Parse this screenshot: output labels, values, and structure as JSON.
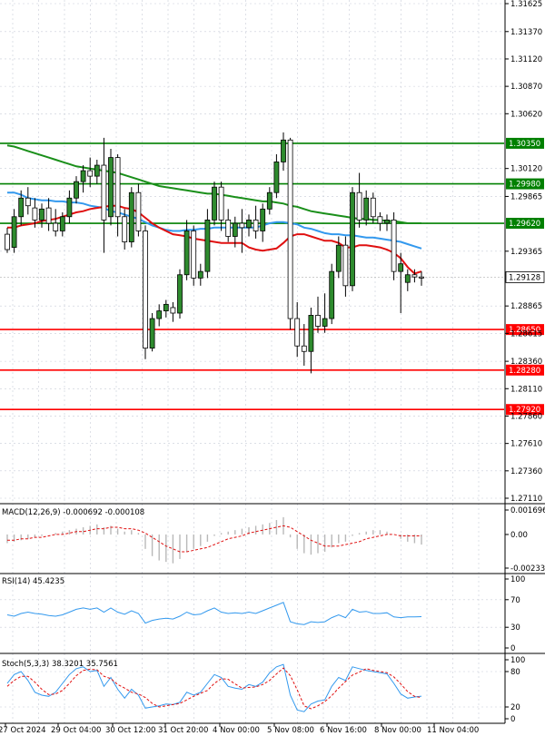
{
  "chart_data": {
    "type": "candlestick",
    "symbol_hint": "GBPUSD H4",
    "price_axis": {
      "ticks": [
        "1.31625",
        "1.31370",
        "1.31120",
        "1.30870",
        "1.30620",
        "1.30120",
        "1.29865",
        "1.29365",
        "1.28865",
        "1.28615",
        "1.28360",
        "1.28110",
        "1.27860",
        "1.27610",
        "1.27360",
        "1.27110"
      ],
      "range": [
        1.2711,
        1.3163
      ]
    },
    "time_axis": {
      "labels": [
        "27 Oct 2024",
        "29 Oct 04:00",
        "30 Oct 12:00",
        "31 Oct 20:00",
        "4 Nov 00:00",
        "5 Nov 08:00",
        "6 Nov 16:00",
        "8 Nov 00:00",
        "11 Nov 04:00"
      ]
    },
    "current_price": {
      "label": "1.29128",
      "value": 1.29128
    },
    "levels": [
      {
        "label": "1.30350",
        "value": 1.3035,
        "color": "#008000"
      },
      {
        "label": "1.29980",
        "value": 1.2998,
        "color": "#008000"
      },
      {
        "label": "1.29620",
        "value": 1.2962,
        "color": "#008000"
      },
      {
        "label": "1.28650",
        "value": 1.2865,
        "color": "#ff0000"
      },
      {
        "label": "1.28280",
        "value": 1.2828,
        "color": "#ff0000"
      },
      {
        "label": "1.27920",
        "value": 1.2792,
        "color": "#ff0000"
      }
    ],
    "candles": [
      {
        "o": 1.2952,
        "h": 1.2958,
        "c": 1.2938,
        "l": 1.2935
      },
      {
        "o": 1.294,
        "h": 1.2975,
        "c": 1.2968,
        "l": 1.2935
      },
      {
        "o": 1.2968,
        "h": 1.2992,
        "c": 1.2985,
        "l": 1.296
      },
      {
        "o": 1.2985,
        "h": 1.2995,
        "c": 1.2978,
        "l": 1.297
      },
      {
        "o": 1.2976,
        "h": 1.2985,
        "c": 1.2965,
        "l": 1.2958
      },
      {
        "o": 1.2965,
        "h": 1.298,
        "c": 1.2975,
        "l": 1.2958
      },
      {
        "o": 1.2976,
        "h": 1.2985,
        "c": 1.2962,
        "l": 1.2955
      },
      {
        "o": 1.2962,
        "h": 1.2975,
        "c": 1.2955,
        "l": 1.295
      },
      {
        "o": 1.2955,
        "h": 1.2972,
        "c": 1.2968,
        "l": 1.295
      },
      {
        "o": 1.2968,
        "h": 1.2992,
        "c": 1.2985,
        "l": 1.2962
      },
      {
        "o": 1.2985,
        "h": 1.3005,
        "c": 1.3,
        "l": 1.298
      },
      {
        "o": 1.3,
        "h": 1.3015,
        "c": 1.301,
        "l": 1.299
      },
      {
        "o": 1.301,
        "h": 1.3022,
        "c": 1.3005,
        "l": 1.2995
      },
      {
        "o": 1.3005,
        "h": 1.302,
        "c": 1.3015,
        "l": 1.2998
      },
      {
        "o": 1.3015,
        "h": 1.304,
        "c": 1.2965,
        "l": 1.2935
      },
      {
        "o": 1.2968,
        "h": 1.303,
        "c": 1.3022,
        "l": 1.296
      },
      {
        "o": 1.3022,
        "h": 1.3025,
        "c": 1.2968,
        "l": 1.295
      },
      {
        "o": 1.2968,
        "h": 1.2975,
        "c": 1.2945,
        "l": 1.2938
      },
      {
        "o": 1.2945,
        "h": 1.2995,
        "c": 1.299,
        "l": 1.294
      },
      {
        "o": 1.299,
        "h": 1.2998,
        "c": 1.2955,
        "l": 1.295
      },
      {
        "o": 1.2955,
        "h": 1.296,
        "c": 1.2848,
        "l": 1.2838
      },
      {
        "o": 1.2848,
        "h": 1.288,
        "c": 1.2875,
        "l": 1.2845
      },
      {
        "o": 1.2875,
        "h": 1.2888,
        "c": 1.2882,
        "l": 1.2868
      },
      {
        "o": 1.2882,
        "h": 1.2892,
        "c": 1.2888,
        "l": 1.2876
      },
      {
        "o": 1.2885,
        "h": 1.289,
        "c": 1.288,
        "l": 1.2872
      },
      {
        "o": 1.288,
        "h": 1.292,
        "c": 1.2915,
        "l": 1.2875
      },
      {
        "o": 1.2915,
        "h": 1.2965,
        "c": 1.2955,
        "l": 1.291
      },
      {
        "o": 1.2955,
        "h": 1.296,
        "c": 1.2912,
        "l": 1.2905
      },
      {
        "o": 1.2912,
        "h": 1.2925,
        "c": 1.2918,
        "l": 1.2905
      },
      {
        "o": 1.2918,
        "h": 1.2975,
        "c": 1.2965,
        "l": 1.2912
      },
      {
        "o": 1.2965,
        "h": 1.3,
        "c": 1.2995,
        "l": 1.296
      },
      {
        "o": 1.2995,
        "h": 1.3,
        "c": 1.2965,
        "l": 1.2955
      },
      {
        "o": 1.2965,
        "h": 1.2975,
        "c": 1.295,
        "l": 1.2945
      },
      {
        "o": 1.295,
        "h": 1.2968,
        "c": 1.2962,
        "l": 1.294
      },
      {
        "o": 1.2962,
        "h": 1.2975,
        "c": 1.2958,
        "l": 1.2935
      },
      {
        "o": 1.2958,
        "h": 1.297,
        "c": 1.2965,
        "l": 1.295
      },
      {
        "o": 1.2965,
        "h": 1.2978,
        "c": 1.2955,
        "l": 1.2948
      },
      {
        "o": 1.2955,
        "h": 1.298,
        "c": 1.2975,
        "l": 1.2945
      },
      {
        "o": 1.2975,
        "h": 1.2995,
        "c": 1.299,
        "l": 1.297
      },
      {
        "o": 1.299,
        "h": 1.3025,
        "c": 1.3018,
        "l": 1.2985
      },
      {
        "o": 1.3018,
        "h": 1.3045,
        "c": 1.3038,
        "l": 1.301
      },
      {
        "o": 1.3038,
        "h": 1.304,
        "c": 1.2875,
        "l": 1.2865
      },
      {
        "o": 1.2875,
        "h": 1.289,
        "c": 1.285,
        "l": 1.284
      },
      {
        "o": 1.285,
        "h": 1.287,
        "c": 1.2845,
        "l": 1.2832
      },
      {
        "o": 1.2845,
        "h": 1.2885,
        "c": 1.2878,
        "l": 1.2825
      },
      {
        "o": 1.2878,
        "h": 1.2895,
        "c": 1.2868,
        "l": 1.2862
      },
      {
        "o": 1.2868,
        "h": 1.2898,
        "c": 1.2875,
        "l": 1.2862
      },
      {
        "o": 1.2875,
        "h": 1.2925,
        "c": 1.2918,
        "l": 1.287
      },
      {
        "o": 1.2918,
        "h": 1.295,
        "c": 1.2942,
        "l": 1.2912
      },
      {
        "o": 1.2942,
        "h": 1.295,
        "c": 1.2905,
        "l": 1.2895
      },
      {
        "o": 1.2905,
        "h": 1.2995,
        "c": 1.299,
        "l": 1.29
      },
      {
        "o": 1.299,
        "h": 1.3008,
        "c": 1.2965,
        "l": 1.2958
      },
      {
        "o": 1.2965,
        "h": 1.2992,
        "c": 1.2985,
        "l": 1.296
      },
      {
        "o": 1.2985,
        "h": 1.299,
        "c": 1.2968,
        "l": 1.2962
      },
      {
        "o": 1.2968,
        "h": 1.2972,
        "c": 1.2962,
        "l": 1.2955
      },
      {
        "o": 1.2962,
        "h": 1.297,
        "c": 1.2965,
        "l": 1.2955
      },
      {
        "o": 1.2965,
        "h": 1.2972,
        "c": 1.2918,
        "l": 1.291
      },
      {
        "o": 1.2918,
        "h": 1.2935,
        "c": 1.2925,
        "l": 1.288
      },
      {
        "o": 1.2908,
        "h": 1.292,
        "c": 1.2915,
        "l": 1.29
      },
      {
        "o": 1.2915,
        "h": 1.292,
        "c": 1.2913,
        "l": 1.2908
      },
      {
        "o": 1.2913,
        "h": 1.2918,
        "c": 1.2912,
        "l": 1.2905
      }
    ],
    "ma_red": [
      1.2958,
      1.2958,
      1.296,
      1.2961,
      1.2962,
      1.2964,
      1.2965,
      1.2966,
      1.2968,
      1.297,
      1.2972,
      1.2973,
      1.2975,
      1.2976,
      1.2977,
      1.2978,
      1.2978,
      1.2976,
      1.2975,
      1.2972,
      1.2967,
      1.2962,
      1.2958,
      1.2955,
      1.2952,
      1.2951,
      1.295,
      1.2948,
      1.2947,
      1.2946,
      1.2945,
      1.2944,
      1.2944,
      1.2944,
      1.2944,
      1.294,
      1.2938,
      1.2937,
      1.2938,
      1.2939,
      1.2944,
      1.295,
      1.2952,
      1.2952,
      1.295,
      1.2948,
      1.2946,
      1.2946,
      1.2944,
      1.294,
      1.294,
      1.2942,
      1.2942,
      1.2941,
      1.294,
      1.2938,
      1.2935,
      1.293,
      1.2922,
      1.2916,
      1.2918
    ],
    "ma_blue": [
      1.299,
      1.299,
      1.2988,
      1.2985,
      1.2984,
      1.2983,
      1.2983,
      1.2982,
      1.2982,
      1.2981,
      1.2981,
      1.298,
      1.2978,
      1.2977,
      1.2976,
      1.2973,
      1.2972,
      1.297,
      1.2968,
      1.2966,
      1.2963,
      1.296,
      1.2958,
      1.2956,
      1.2955,
      1.2955,
      1.2956,
      1.2956,
      1.2957,
      1.2957,
      1.2958,
      1.2958,
      1.2958,
      1.2958,
      1.2958,
      1.2958,
      1.2958,
      1.296,
      1.2962,
      1.2963,
      1.2963,
      1.2962,
      1.2961,
      1.2958,
      1.2957,
      1.2955,
      1.2953,
      1.2952,
      1.2952,
      1.2951,
      1.2951,
      1.295,
      1.2949,
      1.2949,
      1.2948,
      1.2947,
      1.2946,
      1.2945,
      1.2943,
      1.2941,
      1.2939
    ],
    "ma_green": [
      1.3033,
      1.3032,
      1.303,
      1.3028,
      1.3026,
      1.3024,
      1.3022,
      1.302,
      1.3018,
      1.3016,
      1.3014,
      1.3013,
      1.3012,
      1.3011,
      1.301,
      1.3009,
      1.3008,
      1.3006,
      1.3004,
      1.3002,
      1.3,
      1.2998,
      1.2996,
      1.2995,
      1.2994,
      1.2993,
      1.2992,
      1.2991,
      1.299,
      1.2989,
      1.2989,
      1.2988,
      1.2987,
      1.2986,
      1.2985,
      1.2984,
      1.2983,
      1.2982,
      1.2982,
      1.2981,
      1.298,
      1.2978,
      1.2977,
      1.2975,
      1.2973,
      1.2972,
      1.2971,
      1.297,
      1.2969,
      1.2968,
      1.2967,
      1.2966,
      1.2966,
      1.2965,
      1.2965,
      1.2964,
      1.2964,
      1.2963,
      1.2962,
      1.2962,
      1.2962
    ],
    "macd": {
      "label": "MACD(12,26,9) -0.000692 -0.000108",
      "ticks": [
        "0.001696",
        "0.00",
        "-0.002332"
      ],
      "range": [
        -0.002332,
        0.001696
      ],
      "hist": [
        -0.0006,
        -0.0005,
        -0.0004,
        -0.0003,
        -0.0002,
        -0.0001,
        0.0,
        0.0001,
        0.0002,
        0.0003,
        0.0004,
        0.0005,
        0.0006,
        0.0007,
        0.0005,
        0.0006,
        0.0004,
        0.0002,
        0.0003,
        0.0001,
        -0.001,
        -0.0015,
        -0.0018,
        -0.0019,
        -0.002,
        -0.0017,
        -0.0012,
        -0.001,
        -0.0008,
        -0.0005,
        -0.0001,
        0.0001,
        0.0002,
        0.0003,
        0.0004,
        0.0005,
        0.0006,
        0.0007,
        0.0008,
        0.001,
        0.0012,
        -0.0002,
        -0.001,
        -0.0013,
        -0.0014,
        -0.0013,
        -0.0012,
        -0.0009,
        -0.0006,
        -0.0005,
        -0.0001,
        0.0001,
        0.0002,
        0.0003,
        0.0003,
        0.0002,
        0.0,
        -0.0003,
        -0.0005,
        -0.0006,
        -0.0007
      ],
      "signal": [
        -0.0004,
        -0.0004,
        -0.0003,
        -0.0003,
        -0.0002,
        -0.0002,
        -0.0001,
        0.0,
        0.0,
        0.0001,
        0.0002,
        0.0002,
        0.0003,
        0.0004,
        0.0004,
        0.0005,
        0.0005,
        0.0004,
        0.0004,
        0.0003,
        0.0001,
        -0.0002,
        -0.0005,
        -0.0008,
        -0.001,
        -0.0012,
        -0.0012,
        -0.0011,
        -0.001,
        -0.0009,
        -0.0007,
        -0.0005,
        -0.0003,
        -0.0002,
        -0.0001,
        0.0001,
        0.0002,
        0.0003,
        0.0004,
        0.0005,
        0.0006,
        0.0005,
        0.0002,
        -0.0001,
        -0.0004,
        -0.0006,
        -0.0008,
        -0.0008,
        -0.0008,
        -0.0007,
        -0.0006,
        -0.0005,
        -0.0003,
        -0.0002,
        -0.0001,
        0.0,
        0.0,
        -0.0001,
        -0.0001,
        -0.0001,
        -0.0001
      ]
    },
    "rsi": {
      "label": "RSI(14) 45.4235",
      "ticks": [
        "100",
        "70",
        "30",
        "0"
      ],
      "values": [
        48,
        46,
        50,
        52,
        50,
        49,
        47,
        46,
        48,
        52,
        56,
        58,
        56,
        58,
        52,
        58,
        52,
        49,
        54,
        50,
        36,
        40,
        42,
        43,
        42,
        46,
        52,
        48,
        49,
        54,
        58,
        52,
        50,
        51,
        50,
        52,
        50,
        54,
        58,
        62,
        66,
        38,
        35,
        34,
        38,
        37,
        38,
        44,
        48,
        44,
        56,
        52,
        53,
        50,
        50,
        51,
        45,
        44,
        45,
        45,
        45.4
      ]
    },
    "stoch": {
      "label": "Stoch(5,3,3) 38.3201 35.7561",
      "ticks": [
        "100",
        "80",
        "20",
        "0"
      ],
      "k": [
        60,
        75,
        80,
        65,
        45,
        40,
        38,
        45,
        60,
        75,
        85,
        88,
        80,
        82,
        55,
        70,
        50,
        35,
        50,
        40,
        18,
        20,
        22,
        25,
        24,
        28,
        45,
        40,
        45,
        60,
        75,
        70,
        55,
        52,
        50,
        58,
        55,
        62,
        78,
        88,
        92,
        40,
        15,
        12,
        25,
        30,
        32,
        55,
        70,
        65,
        88,
        85,
        82,
        80,
        78,
        76,
        60,
        42,
        35,
        37,
        38.3
      ],
      "d": [
        55,
        65,
        72,
        72,
        62,
        50,
        41,
        42,
        48,
        60,
        73,
        82,
        84,
        83,
        72,
        68,
        58,
        52,
        45,
        42,
        36,
        26,
        20,
        22,
        24,
        26,
        32,
        38,
        43,
        48,
        60,
        68,
        67,
        59,
        52,
        53,
        54,
        58,
        65,
        76,
        86,
        73,
        49,
        22,
        17,
        22,
        29,
        39,
        52,
        63,
        74,
        79,
        85,
        82,
        80,
        78,
        71,
        59,
        46,
        38,
        35.8
      ]
    }
  }
}
